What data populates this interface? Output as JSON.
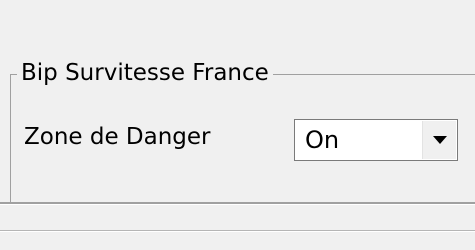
{
  "group": {
    "title": "Bip Survitesse France"
  },
  "danger_zone": {
    "label": "Zone de Danger",
    "value": "On"
  }
}
